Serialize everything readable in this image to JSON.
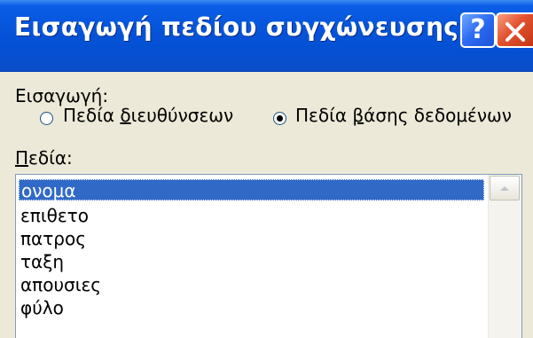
{
  "window": {
    "title": "Εισαγωγή πεδίου συγχώνευσης",
    "help_label": "?",
    "help_icon": "question-mark-icon",
    "close_icon": "close-x-icon"
  },
  "insert": {
    "label": "Εισαγωγή:",
    "options": [
      {
        "prefix": "Πεδία ",
        "accel": "δ",
        "suffix": "ιευθύνσεων",
        "selected": false
      },
      {
        "prefix": "Πεδία ",
        "accel": "β",
        "suffix": "άσης δεδομένων",
        "selected": true
      }
    ]
  },
  "fields": {
    "label_accel": "Π",
    "label_rest": "εδία:",
    "items": [
      "ονομα",
      "επιθετο",
      "πατρος",
      "ταξη",
      "απουσιες",
      "φύλο"
    ],
    "selected_index": 0
  },
  "colors": {
    "titlebar": "#0553d9",
    "selection": "#3169c6",
    "dialog_bg": "#ece9d8",
    "close_button": "#e3522f",
    "help_button": "#2b6af2"
  }
}
